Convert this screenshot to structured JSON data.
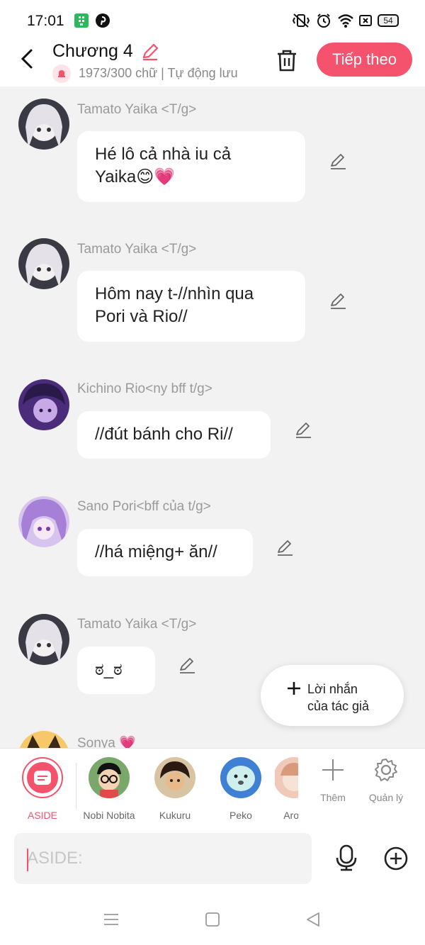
{
  "status_bar": {
    "time": "17:01",
    "battery": "54",
    "icons": [
      "app-notification-icon",
      "pinterest-icon",
      "vibrate-icon",
      "alarm-icon",
      "wifi-icon",
      "sim-icon",
      "battery-icon"
    ]
  },
  "header": {
    "title": "Chương 4",
    "word_count": "1973/300 chữ",
    "autosave": "Tự động lưu",
    "next_label": "Tiếp theo"
  },
  "messages": [
    {
      "name": "Tamato Yaika <T/g>",
      "line1": "Hé lô cả nhà iu cả",
      "line2": "Yaika😊💗",
      "avatar": "white-haired-anime-girl"
    },
    {
      "name": "Tamato Yaika <T/g>",
      "line1": "Hôm nay t-//nhìn qua",
      "line2": "Pori và Rio//",
      "avatar": "white-haired-anime-girl"
    },
    {
      "name": "Kichino Rio<ny bff t/g>",
      "line1": "//đút bánh cho Ri//",
      "avatar": "purple-anime-boy"
    },
    {
      "name": "Sano Pori<bff của t/g>",
      "line1": "//há miệng+ ăn//",
      "avatar": "purple-haired-anime-girl"
    },
    {
      "name": "Tamato Yaika <T/g>",
      "line1": "ಠ_ಠ",
      "avatar": "white-haired-anime-girl"
    },
    {
      "name": "Sonya 💗",
      "avatar": "anime-girl-with-cat-ears"
    }
  ],
  "floating_button": {
    "line1": "Lời nhắn",
    "line2": "của tác giả"
  },
  "characters": [
    {
      "label": "ASIDE"
    },
    {
      "label": "Nobi Nobita"
    },
    {
      "label": "Kukuru"
    },
    {
      "label": "Peko"
    },
    {
      "label": "Aron"
    }
  ],
  "tools": {
    "add_label": "Thêm",
    "manage_label": "Quản lý"
  },
  "input": {
    "placeholder": "ASIDE:"
  },
  "colors": {
    "accent": "#f5536d",
    "background": "#f2f2f2",
    "bubble": "#ffffff",
    "name_text": "#9a9a9a"
  }
}
